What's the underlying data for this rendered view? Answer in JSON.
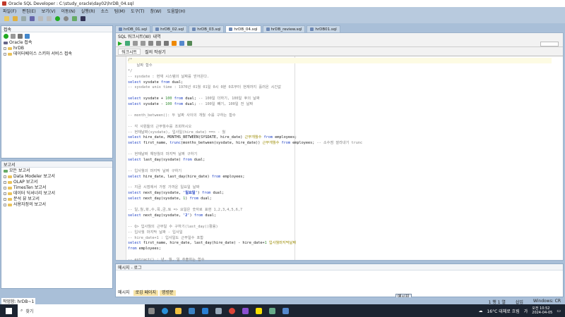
{
  "title": "Oracle SQL Developer : C:\\study_oracle\\day02\\hrDB_04.sql",
  "menu": [
    "파일(F)",
    "편집(E)",
    "보기(V)",
    "이동(N)",
    "실행(R)",
    "소스",
    "팀(M)",
    "도구(T)",
    "창(W)",
    "도움말(H)"
  ],
  "connections": {
    "title": "접속",
    "items": [
      "Oracle 접속",
      "hrDB",
      "데이터베이스 스키마 서비스 접속"
    ]
  },
  "reports": {
    "title": "보고서",
    "items": [
      "모든 보고서",
      "Data Modeler 보고서",
      "OLAP 보고서",
      "TimesTen 보고서",
      "데이터 딕셔너리 보고서",
      "분석 뷰 보고서",
      "사용자정의 보고서"
    ]
  },
  "tabs": [
    "hrDB_01.sql",
    "hrDB_02.sql",
    "hrDB_03.sql",
    "hrDB_04.sql",
    "hrDB_review.sql",
    "hrDB01.sql"
  ],
  "active_tab": 3,
  "worksheet": {
    "label": "SQL 워크시트(W)",
    "history": "내역",
    "subtabs": [
      "워크시트",
      "질의 작성기"
    ]
  },
  "code": [
    [
      [
        "/*",
        "cm"
      ]
    ],
    [
      [
        "    날짜 함수",
        "cm"
      ]
    ],
    [
      [
        "*/",
        "cm"
      ]
    ],
    [
      [
        "-- sysdate : 현재 시스템의 날짜를 얻어온다.",
        "cm"
      ]
    ],
    [
      [
        "select",
        "kw"
      ],
      [
        " sysdate ",
        "tx"
      ],
      [
        "from",
        "kw"
      ],
      [
        " dual;",
        "tx"
      ]
    ],
    [
      [
        "-- sysdate unix time : 1970년 01월 01일 0시 0분 0초부터 현재까지 흘러온 시간값",
        "cm"
      ]
    ],
    [],
    [
      [
        "select",
        "kw"
      ],
      [
        " sysdate + ",
        "tx"
      ],
      [
        "100",
        "num"
      ],
      [
        " ",
        "tx"
      ],
      [
        "from",
        "kw"
      ],
      [
        " dual; ",
        "tx"
      ],
      [
        "-- 100일 더하기, 100일 후의 날짜",
        "cm"
      ]
    ],
    [
      [
        "select",
        "kw"
      ],
      [
        " sysdate - ",
        "tx"
      ],
      [
        "100",
        "num"
      ],
      [
        " ",
        "tx"
      ],
      [
        "from",
        "kw"
      ],
      [
        " dual; ",
        "tx"
      ],
      [
        "-- 100일 빼기, 100일 전 날짜",
        "cm"
      ]
    ],
    [],
    [
      [
        "-- month_between(): 두 날짜 사이의 개월 수를 구하는 함수",
        "cm"
      ]
    ],
    [],
    [
      [
        "-- 각 사원들의 근무월수를 조회하시오",
        "cm"
      ]
    ],
    [
      [
        "-- 현재날짜(sysdate), 입사일(hire_date) ==> - 월",
        "cm"
      ]
    ],
    [
      [
        "select",
        "kw"
      ],
      [
        " hire_date, MONTHS_BETWEEN(SYSDATE, hire_date) ",
        "tx"
      ],
      [
        "근무개월수",
        "al"
      ],
      [
        " ",
        "tx"
      ],
      [
        "from",
        "kw"
      ],
      [
        " employees;",
        "tx"
      ]
    ],
    [
      [
        "select",
        "kw"
      ],
      [
        " first_name, ",
        "tx"
      ],
      [
        "trunc",
        "kw"
      ],
      [
        "(months_between(sysdate, hire_date)) ",
        "tx"
      ],
      [
        "근무개월수",
        "al"
      ],
      [
        " ",
        "tx"
      ],
      [
        "from",
        "kw"
      ],
      [
        " employees; ",
        "tx"
      ],
      [
        "-- 소수점 잘라내기 trunc",
        "cm"
      ]
    ],
    [],
    [
      [
        "-- 현재날짜 해당월의 마지막 날짜 구하기",
        "cm"
      ]
    ],
    [
      [
        "select",
        "kw"
      ],
      [
        " last_day(sysdate) ",
        "tx"
      ],
      [
        "from",
        "kw"
      ],
      [
        " dual;",
        "tx"
      ]
    ],
    [],
    [
      [
        "-- 입사월의 마지막 날짜 구하기",
        "cm"
      ]
    ],
    [
      [
        "select",
        "kw"
      ],
      [
        " hire_date, last_day(hire_date) ",
        "tx"
      ],
      [
        "from",
        "kw"
      ],
      [
        " employees;",
        "tx"
      ]
    ],
    [],
    [
      [
        "-- 지금 시점에서 가장 가까운 일요일 날짜",
        "cm"
      ]
    ],
    [
      [
        "select",
        "kw"
      ],
      [
        " next_day(sysdate, ",
        "tx"
      ],
      [
        "'일요일'",
        "str"
      ],
      [
        ") ",
        "tx"
      ],
      [
        "from",
        "kw"
      ],
      [
        " dual;",
        "tx"
      ]
    ],
    [
      [
        "select",
        "kw"
      ],
      [
        " next_day(sysdate, ",
        "tx"
      ],
      [
        "1",
        "num"
      ],
      [
        ") ",
        "tx"
      ],
      [
        "from",
        "kw"
      ],
      [
        " dual;",
        "tx"
      ]
    ],
    [],
    [
      [
        "-- 일,월,화,수,목,금,토 => 요일은 숫자로 표현 1,2,3,4,5,6,7",
        "cm"
      ]
    ],
    [
      [
        "select",
        "kw"
      ],
      [
        " next_day(sysdate, ",
        "tx"
      ],
      [
        "'2'",
        "str"
      ],
      [
        ") ",
        "tx"
      ],
      [
        "from",
        "kw"
      ],
      [
        " dual;",
        "tx"
      ]
    ],
    [],
    [
      [
        "-- Q> 입사월의 근무일 수 구하기(last_day()활용)",
        "cm"
      ]
    ],
    [
      [
        "-- 입사월 마지막 날짜 - 입사일",
        "cm"
      ]
    ],
    [
      [
        "-- hire_date+1 : 입사일도 근무일수 포함",
        "cm"
      ]
    ],
    [
      [
        "select",
        "kw"
      ],
      [
        " first_name, hire_date, last_day(hire_date) - hire_date+",
        "tx"
      ],
      [
        "1",
        "num"
      ],
      [
        " ",
        "tx"
      ],
      [
        "입사월마지막날짜",
        "al"
      ]
    ],
    [
      [
        "from",
        "kw"
      ],
      [
        " employees;",
        "tx"
      ]
    ],
    [],
    [
      [
        "-- extract() : 년, 월, 일 추출하는 함수",
        "cm"
      ]
    ]
  ],
  "messages": {
    "title": "메시지 - 로그",
    "tabs": [
      "메시지",
      "로깅 페이지",
      "명령문"
    ],
    "tooltip": "메시지"
  },
  "status": {
    "left": "작업함: hrDB~1",
    "line": "1 행 1 열",
    "mode": "삽입",
    "eol": "Windows: CR"
  },
  "taskbar": {
    "search": "찾기",
    "weather": "16°C 대체로 흐림",
    "ime": "가",
    "time": "오전 10:52",
    "date": "2024-04-05"
  }
}
